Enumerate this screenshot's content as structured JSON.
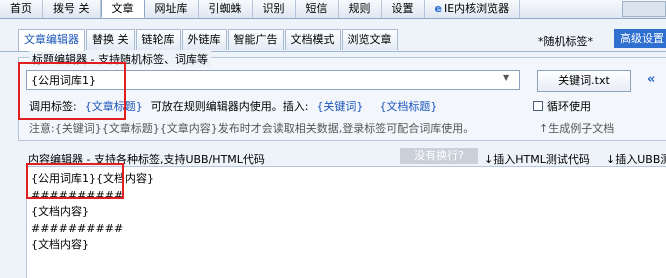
{
  "menu": {
    "tabs": [
      "首页",
      "拨号 关",
      "文章",
      "网址库",
      "引蜘蛛",
      "识别",
      "短信",
      "规则",
      "设置"
    ],
    "ie_tab": "IE内核浏览器"
  },
  "subtabs": [
    "文章编辑器",
    "替换 关",
    "链轮库",
    "外链库",
    "智能广告",
    "文档模式",
    "浏览文章"
  ],
  "random_tag": "*随机标签*",
  "advanced_label": "高级设置",
  "title_editor": {
    "legend": "标题编辑器 - 支持随机标签、词库等",
    "value": "{公用词库1}",
    "keyword_button": "关键词.txt",
    "tag_label": "调用标签:",
    "tag_link": "{文章标题}",
    "tag_hint": "可放在规则编辑器内使用。插入:",
    "insert_keyword": "{关键词}",
    "insert_title": "{文档标题}",
    "loop_label": "循环使用",
    "note": "注意:{关键词}{文章标题}{文章内容}发布时才会读取相关数据,登录标签可配合词库使用。",
    "gen_sample": "↑生成例子文档"
  },
  "content_editor": {
    "legend": "内容编辑器 - 支持各种标签,支持UBB/HTML代码",
    "no_wrap_button": "没有换行?",
    "insert_html": "↓插入HTML测试代码",
    "insert_ubb": "↓插入UBB测",
    "lines": [
      "{公用词库1}{文档内容}",
      "##########",
      "{文档内容}",
      "##########",
      "{文档内容}"
    ]
  },
  "colors": {
    "accent": "#1a55b8",
    "highlight": "#e02020",
    "advanced_bg": "#2f6fd0"
  }
}
